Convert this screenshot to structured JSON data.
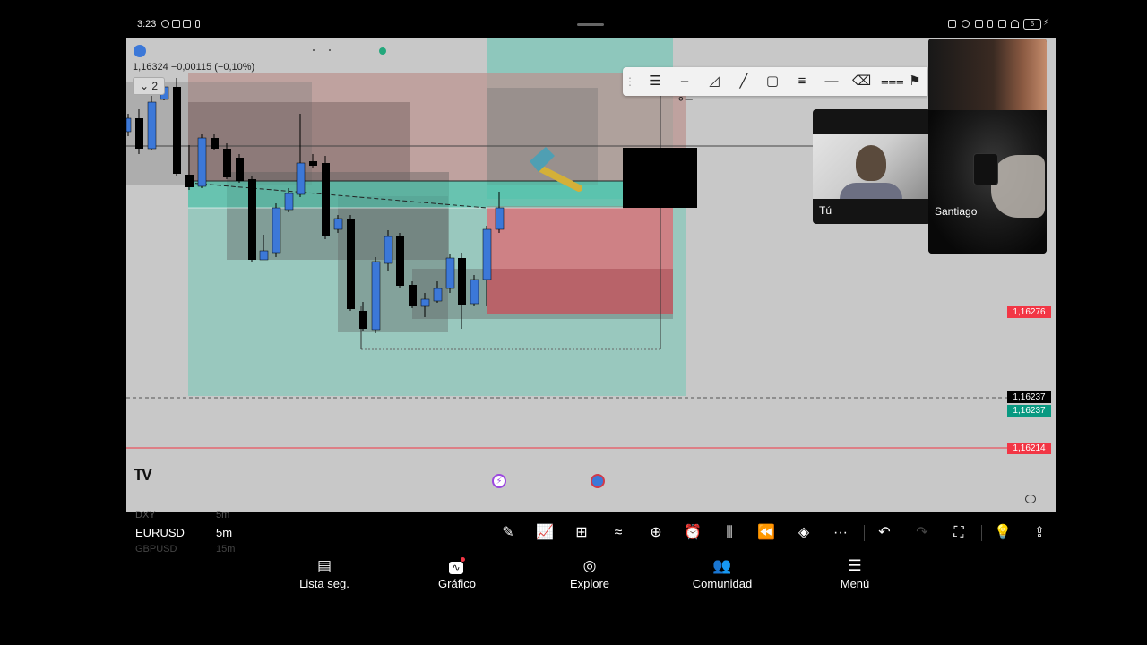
{
  "status_bar": {
    "time": "3:23",
    "icons": [
      "sync-icon",
      "gallery-icon",
      "mail-icon",
      "battery-saver-icon",
      "nfc-icon",
      "eye-icon",
      "bluetooth-icon",
      "wifi-icon",
      "battery-icon"
    ],
    "battery": "5"
  },
  "chart": {
    "symbol_ohlc": "1,16324  −0,00115 (−0,10%)",
    "collapse_count": "2",
    "logo": "TV",
    "price_labels": [
      {
        "value": "1,16276",
        "color": "#f23645"
      },
      {
        "value": "1,16237",
        "color": "#000000"
      },
      {
        "value": "1,16237",
        "color": "#089981"
      },
      {
        "value": "1,16214",
        "color": "#f23645"
      }
    ]
  },
  "drawing_toolbar": {
    "tools": [
      "drag-handle-icon",
      "fib-levels-icon",
      "horizontal-ray-icon",
      "triangle-icon",
      "trend-line-icon",
      "rectangle-icon",
      "parallel-lines-icon",
      "horizontal-line-icon",
      "eraser-icon",
      "pitchfork-icon",
      "flag-icon"
    ]
  },
  "video_call": {
    "self_name": "Tú",
    "remote_name": "Santiago"
  },
  "watchlist": {
    "prev_symbol": "DXY",
    "prev_tf": "5m",
    "current_symbol": "EURUSD",
    "current_tf": "5m",
    "next_symbol": "GBPUSD",
    "next_tf": "15m"
  },
  "bottom_toolbar": {
    "tools": [
      "pencil-icon",
      "indicators-icon",
      "templates-icon",
      "compare-icon",
      "add-icon",
      "alert-icon",
      "candles-icon",
      "replay-icon",
      "layers-icon",
      "more-icon",
      "undo-icon",
      "redo-icon",
      "fullscreen-icon",
      "idea-icon",
      "share-icon"
    ]
  },
  "nav": {
    "items": [
      {
        "label": "Lista seg.",
        "icon": "watchlist-icon"
      },
      {
        "label": "Gráfico",
        "icon": "chart-icon"
      },
      {
        "label": "Explore",
        "icon": "compass-icon"
      },
      {
        "label": "Comunidad",
        "icon": "community-icon"
      },
      {
        "label": "Menú",
        "icon": "menu-icon"
      }
    ]
  }
}
